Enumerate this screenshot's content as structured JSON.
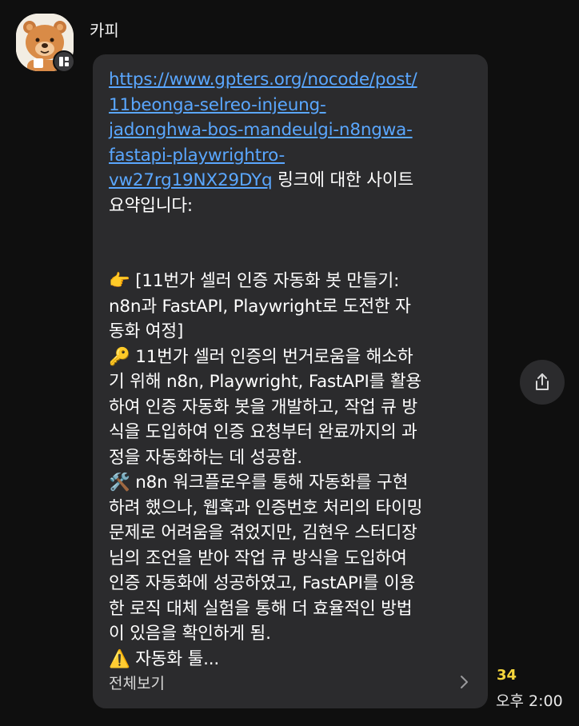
{
  "sender": {
    "name": "카피"
  },
  "message": {
    "link_lines": [
      "https://www.gpters.org/nocode/post/",
      "11beonga-selreo-injeung-",
      "jadonghwa-bos-mandeulgi-n8ngwa-",
      "fastapi-playwrightro-",
      "vw27rg19NX29DYq"
    ],
    "after_link": " 링크에 대한 사이트",
    "intro_line2": "요약입니다:",
    "title_emoji": "👉",
    "title_lines": [
      " [11번가 셀러 인증 자동화 봇 만들기:",
      "n8n과 FastAPI, Playwright로 도전한 자",
      "동화 여정]"
    ],
    "summary_emoji": "🔑",
    "summary_lines": [
      " 11번가 셀러 인증의 번거로움을 해소하",
      "기 위해 n8n, Playwright, FastAPI를 활용",
      "하여 인증 자동화 봇을 개발하고, 작업 큐 방",
      "식을 도입하여 인증 요청부터 완료까지의 과",
      "정을 자동화하는 데 성공함."
    ],
    "tools_emoji": "🛠️",
    "tools_lines": [
      " n8n 워크플로우를 통해 자동화를 구현",
      "하려 했으나, 웹훅과 인증번호 처리의 타이밍",
      "문제로 어려움을 겪었지만, 김현우 스터디장",
      "님의 조언을 받아 작업 큐 방식을 도입하여",
      "인증 자동화에 성공하였고, FastAPI를 이용",
      "한 로직 대체 실험을 통해 더 효율적인 방법",
      "이 있음을 확인하게 됨."
    ],
    "warn_emoji": "⚠️",
    "warn_line": " 자동화 툴...",
    "view_all": "전체보기"
  },
  "meta": {
    "unread_count": "34",
    "time": "오후 2:00"
  },
  "icons": {
    "avatar": "bear-avatar",
    "badge": "app-badge-icon",
    "share": "share-icon",
    "chevron": "chevron-right-icon"
  },
  "colors": {
    "background": "#0f0f0f",
    "bubble": "#2b2b2d",
    "link": "#5aa7ff",
    "count": "#f5d63c"
  }
}
